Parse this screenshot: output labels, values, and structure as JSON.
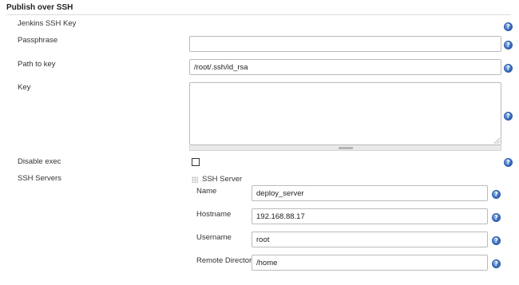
{
  "section": {
    "title": "Publish over SSH"
  },
  "fields": {
    "jenkins_ssh_key": {
      "label": "Jenkins SSH Key"
    },
    "passphrase": {
      "label": "Passphrase",
      "value": ""
    },
    "path_to_key": {
      "label": "Path to key",
      "value": "/root/.ssh/id_rsa"
    },
    "key": {
      "label": "Key",
      "value": ""
    },
    "disable_exec": {
      "label": "Disable exec",
      "checked": false
    }
  },
  "ssh_servers": {
    "label": "SSH Servers",
    "server": {
      "heading": "SSH Server",
      "name": {
        "label": "Name",
        "value": "deploy_server"
      },
      "hostname": {
        "label": "Hostname",
        "value": "192.168.88.17"
      },
      "username": {
        "label": "Username",
        "value": "root"
      },
      "remote_directory": {
        "label": "Remote Directory",
        "value": "/home"
      }
    }
  },
  "icons": {
    "help": "help-icon",
    "help_glyph": "?",
    "drag": "drag-handle-icon",
    "resize": "resize-grip-icon"
  },
  "colors": {
    "help_blue": "#3c6fc2",
    "border": "#bbbbbb"
  }
}
